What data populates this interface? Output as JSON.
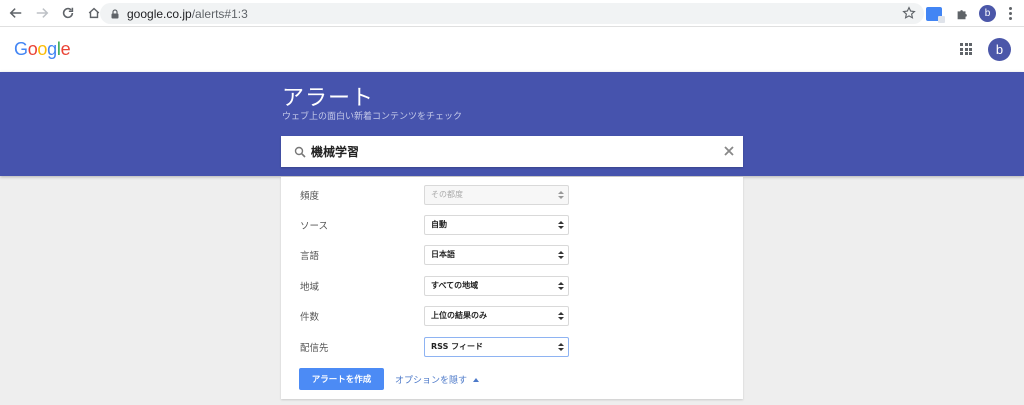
{
  "browser": {
    "url_host": "google.co.jp",
    "url_path": "/alerts#1:3",
    "profile_initial": "b"
  },
  "header": {
    "logo": "Google",
    "logo_colors": [
      "#4285F4",
      "#EA4335",
      "#FBBC05",
      "#4285F4",
      "#34A853",
      "#EA4335"
    ],
    "avatar_initial": "b"
  },
  "banner": {
    "title": "アラート",
    "subtitle": "ウェブ上の面白い新着コンテンツをチェック",
    "color": "#4653ad"
  },
  "search": {
    "query": "機械学習"
  },
  "options": [
    {
      "label": "頻度",
      "value": "その都度",
      "disabled": true
    },
    {
      "label": "ソース",
      "value": "自動"
    },
    {
      "label": "言語",
      "value": "日本語"
    },
    {
      "label": "地域",
      "value": "すべての地域"
    },
    {
      "label": "件数",
      "value": "上位の結果のみ"
    },
    {
      "label": "配信先",
      "value": "RSS フィード",
      "focused": true
    }
  ],
  "actions": {
    "create_label": "アラートを作成",
    "hide_options_label": "オプションを隠す"
  },
  "colors": {
    "accent": "#4c8bf5",
    "link": "#4c79c9"
  }
}
